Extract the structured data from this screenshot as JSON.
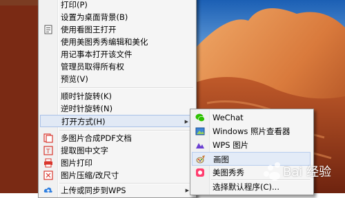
{
  "main_menu": {
    "items": [
      {
        "label": "打印(P)",
        "icon": "",
        "submenu": false
      },
      {
        "label": "设置为桌面背景(B)",
        "icon": "",
        "submenu": false
      },
      {
        "label": "使用看图王打开",
        "icon": "image-viewer-icon",
        "submenu": false
      },
      {
        "label": "使用美图秀秀编辑和美化",
        "icon": "",
        "submenu": false
      },
      {
        "label": "用记事本打开该文件",
        "icon": "",
        "submenu": false
      },
      {
        "label": "管理员取得所有权",
        "icon": "",
        "submenu": false
      },
      {
        "label": "预览(V)",
        "icon": "",
        "submenu": false
      },
      {
        "label": "顺时针旋转(K)",
        "icon": "",
        "submenu": false
      },
      {
        "label": "逆时针旋转(N)",
        "icon": "",
        "submenu": false
      },
      {
        "label": "打开方式(H)",
        "icon": "",
        "submenu": true
      },
      {
        "label": "多图片合成PDF文档",
        "icon": "pdf-merge-icon",
        "submenu": false
      },
      {
        "label": "提取图中文字",
        "icon": "text-extract-icon",
        "submenu": false
      },
      {
        "label": "图片打印",
        "icon": "printer-icon",
        "submenu": false
      },
      {
        "label": "图片压缩/改尺寸",
        "icon": "compress-icon",
        "submenu": false
      },
      {
        "label": "上传或同步到WPS",
        "icon": "cloud-upload-icon",
        "submenu": true
      }
    ]
  },
  "sub_menu": {
    "items": [
      {
        "label": "WeChat",
        "icon": "wechat-icon"
      },
      {
        "label": "Windows 照片查看器",
        "icon": "photo-viewer-icon"
      },
      {
        "label": "WPS 图片",
        "icon": "wps-image-icon"
      },
      {
        "label": "画图",
        "icon": "paint-icon"
      },
      {
        "label": "美图秀秀",
        "icon": "meitu-icon"
      },
      {
        "label": "选择默认程序(C)...",
        "icon": ""
      }
    ]
  },
  "watermark": {
    "text": "Bai 经验"
  },
  "colors": {
    "highlight": "#e1e9f5",
    "menu_bg": "#f5f5f5",
    "border": "#979797"
  }
}
